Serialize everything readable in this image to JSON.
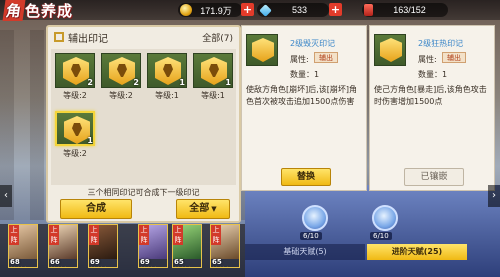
{
  "header": {
    "title_first": "角",
    "title_rest": "色养成",
    "gold": "171.9万",
    "gems": "533",
    "stamina": "163/152",
    "plus_label": "+"
  },
  "mark_panel": {
    "title": "辅出印记",
    "count_label": "全部(7)",
    "marks": [
      {
        "count": "2",
        "level": "等级:2"
      },
      {
        "count": "2",
        "level": "等级:2"
      },
      {
        "count": "1",
        "level": "等级:1"
      },
      {
        "count": "1",
        "level": "等级:1"
      },
      {
        "count": "1",
        "level": "等级:2"
      }
    ],
    "tip": "三个相同印记可合成下一级印记",
    "combine_label": "合成",
    "filter_label": "全部",
    "filter_caret": "▼"
  },
  "detail_cards": [
    {
      "name": "2级毁灭印记",
      "attr_label": "属性:",
      "attr_value": "辅出",
      "qty": "数量：1",
      "desc": "使敌方角色[崩坏]后,该[崩坏]角色首次被攻击追加1500点伤害",
      "button": "替换"
    },
    {
      "name": "2级狂热印记",
      "attr_label": "属性:",
      "attr_value": "辅出",
      "qty": "数量：1",
      "desc": "使己方角色[暴走]后,该角色攻击时伤害增加1500点",
      "button": "已镶嵌"
    }
  ],
  "talent": {
    "node_counts": [
      "6/10",
      "6/10"
    ],
    "tab_basic": "基础天赋(5)",
    "tab_advanced": "进阶天赋(25)"
  },
  "heroes": [
    {
      "level": "68",
      "tag": "上阵",
      "stars": "★★★★★"
    },
    {
      "level": "66",
      "tag": "上阵",
      "stars": "★★★★★"
    },
    {
      "level": "69",
      "tag": "上阵",
      "stars": "★★★★★"
    },
    {
      "level": "69",
      "tag": "上阵",
      "stars": "★★★★★"
    },
    {
      "level": "65",
      "tag": "上阵",
      "stars": "★★★★★"
    },
    {
      "level": "65",
      "tag": "上阵",
      "stars": "★★★★★"
    }
  ],
  "colors": {
    "accent_yellow": "#f0b914",
    "brand_red": "#d23a2a",
    "name_blue": "#3a86c8"
  }
}
